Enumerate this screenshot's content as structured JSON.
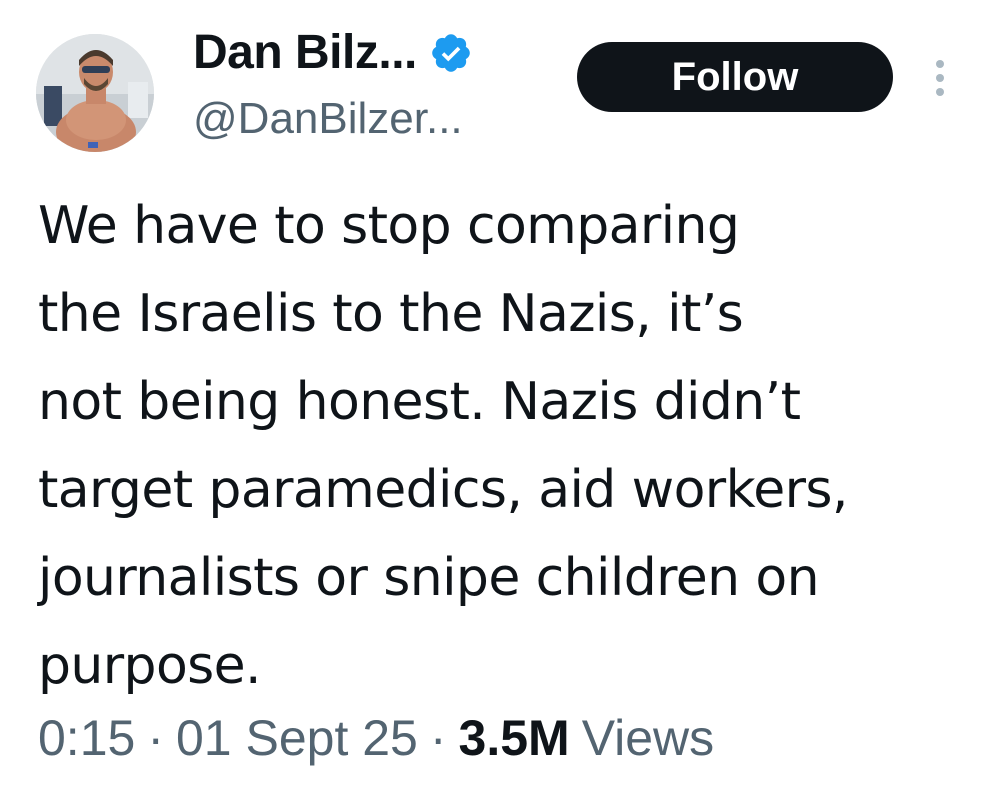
{
  "tweet": {
    "author": {
      "display_name": "Dan Bilz...",
      "handle": "@DanBilzer...",
      "verified": true,
      "avatar_icon": "profile-photo",
      "verified_icon": "verified-badge-icon"
    },
    "follow_label": "Follow",
    "more_icon": "more-vertical-icon",
    "body_lines": [
      "We have to stop comparing",
      "the Israelis to the Nazis, it’s",
      "not being honest. Nazis didn’t",
      "target paramedics, aid workers,",
      "journalists or snipe children on",
      "purpose."
    ],
    "meta": {
      "time": "0:15",
      "separator": "·",
      "date": "01 Sept 25",
      "views_count": "3.5M",
      "views_label": "Views"
    }
  },
  "colors": {
    "primary_text": "#0f1419",
    "secondary_text": "#536471",
    "verified_blue": "#1d9bf0",
    "follow_bg": "#0f1419",
    "follow_text": "#ffffff",
    "background": "#ffffff"
  }
}
